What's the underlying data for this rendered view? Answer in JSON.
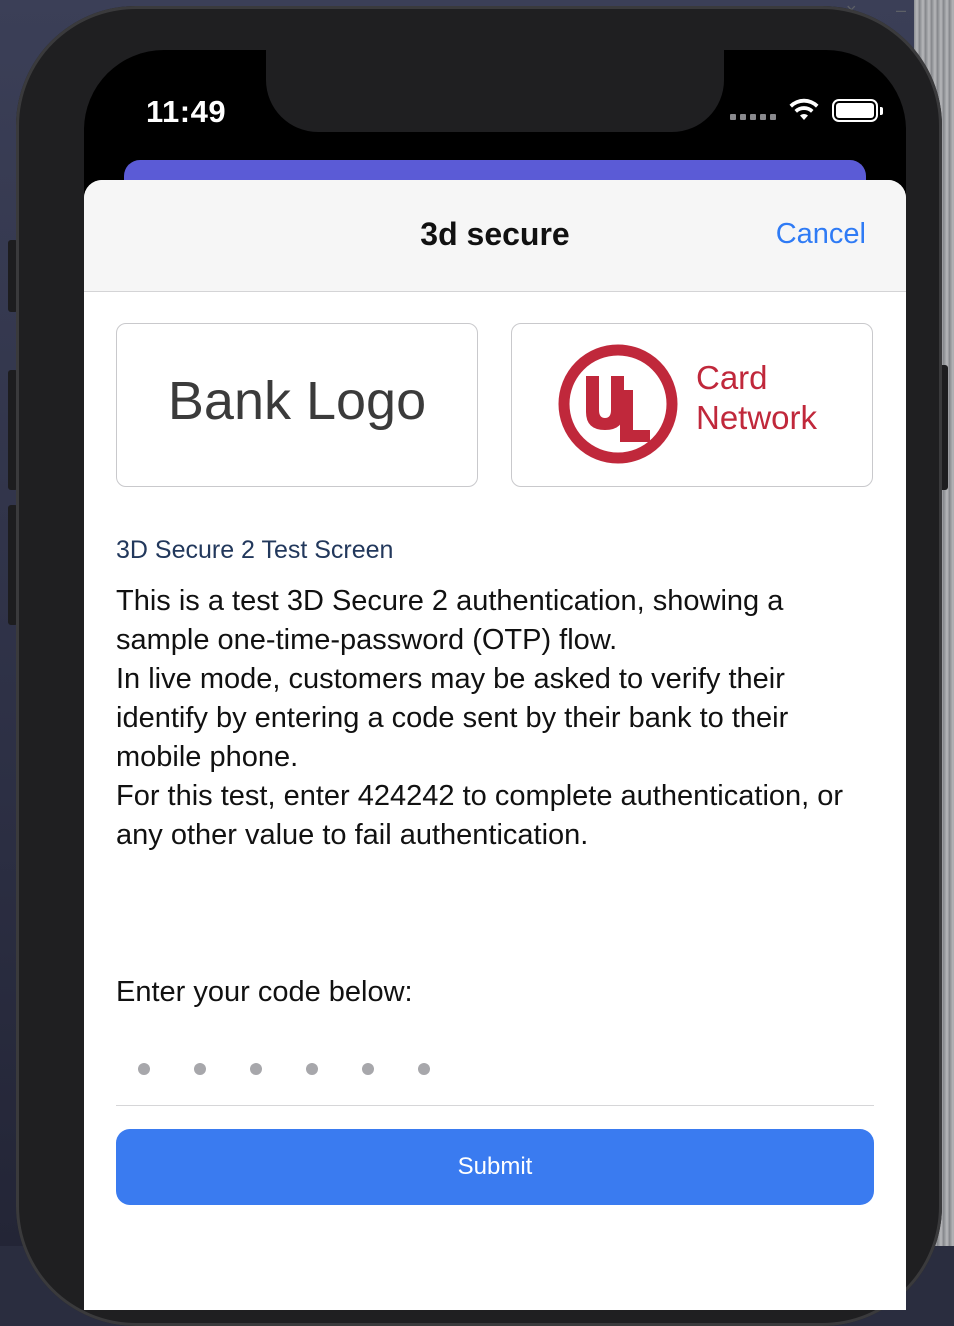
{
  "status_bar": {
    "time": "11:49"
  },
  "sheet": {
    "title": "3d secure",
    "cancel_label": "Cancel"
  },
  "logos": {
    "bank_logo_text": "Bank Logo",
    "card_network_line1": "Card",
    "card_network_line2": "Network",
    "card_network_mark": "UL"
  },
  "content": {
    "heading": "3D Secure 2 Test Screen",
    "paragraph1": "This is a test 3D Secure 2 authentication, showing a sample one-time-password (OTP) flow.",
    "paragraph2": "In live mode, customers may be asked to verify their identify by entering a code sent by their bank to their mobile phone.",
    "paragraph3": "For this test, enter 424242 to complete authentication, or any other value to fail authentication."
  },
  "form": {
    "code_label": "Enter your code below:",
    "code_placeholder": "••••••",
    "submit_label": "Submit"
  },
  "colors": {
    "accent": "#3a7bf0",
    "cancel": "#2f7bf5",
    "card_network": "#c0283b",
    "purple_bar": "#5b5bd6"
  },
  "icons": [
    "wifi-icon",
    "battery-icon",
    "signal-icon",
    "ul-logo-icon"
  ]
}
